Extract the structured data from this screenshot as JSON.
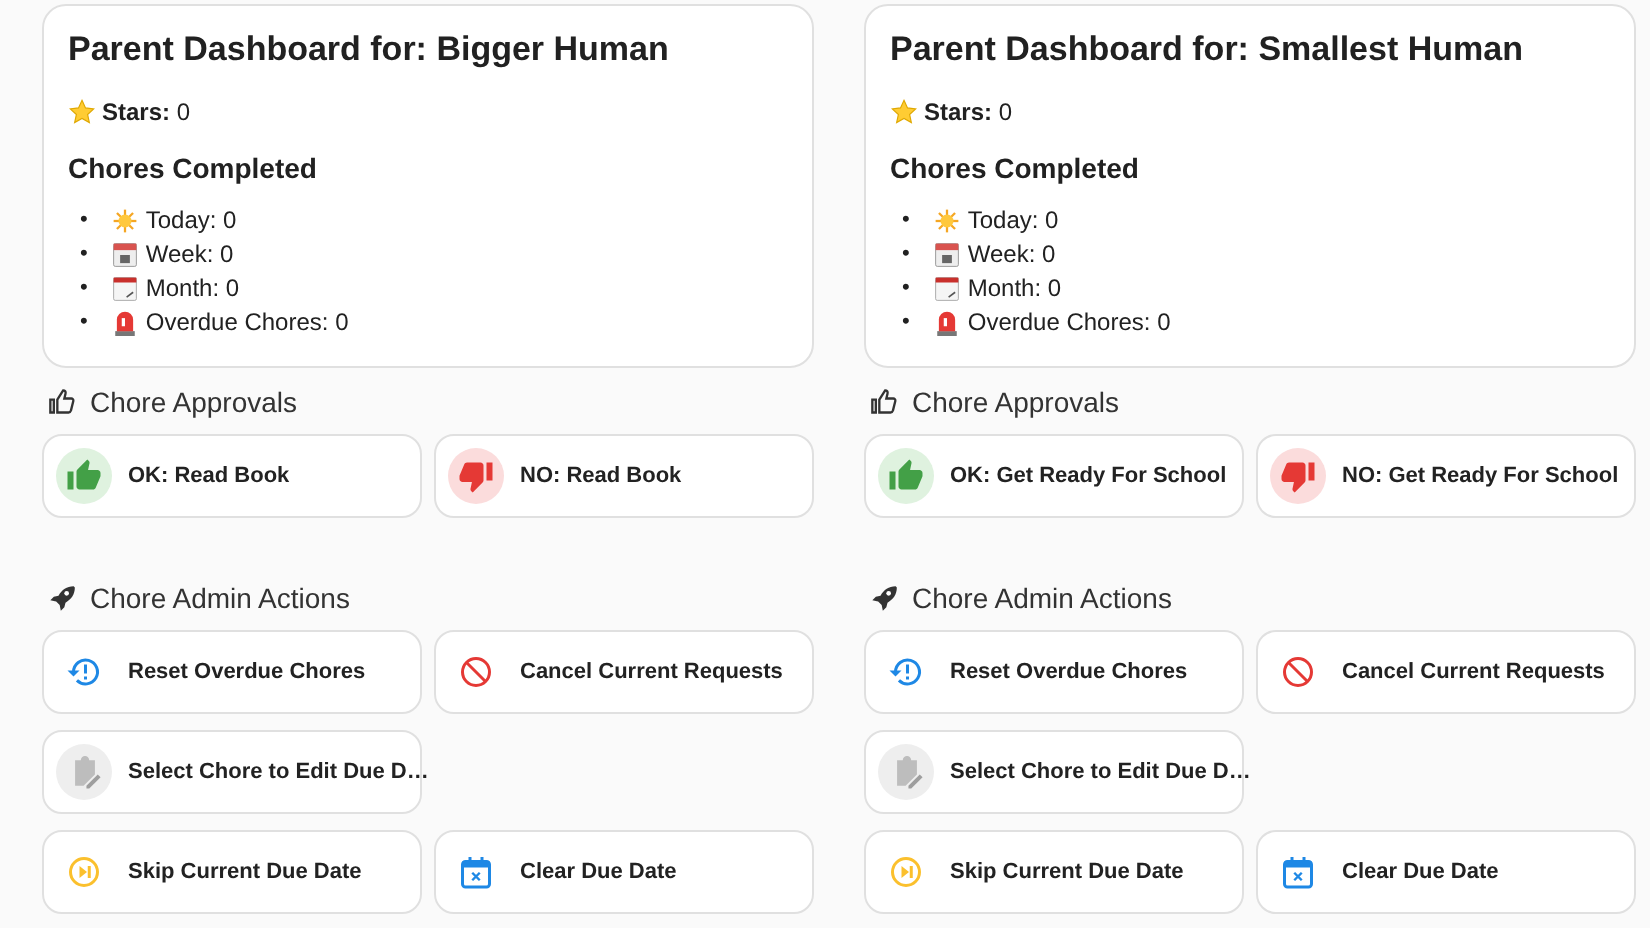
{
  "dashboards": [
    {
      "title": "Parent Dashboard for: Bigger Human",
      "stars": "**Stars:** 0",
      "completed_heading": "Chores Completed",
      "stats": [
        {
          "bullet": "•",
          "kind": "today",
          "text": "Today: 0"
        },
        {
          "bullet": "•",
          "kind": "week",
          "text": "Week: 0"
        },
        {
          "bullet": "•",
          "kind": "month",
          "text": "Month: 0"
        },
        {
          "bullet": "•",
          "kind": "overdue",
          "text": "Overdue Chores: 0"
        }
      ],
      "approvals_heading": "Chore Approvals",
      "approvals": [
        {
          "kind": "ok",
          "label": "OK: Read Book"
        },
        {
          "kind": "no",
          "label": "NO: Read Book"
        }
      ],
      "admin_heading": "Chore Admin Actions",
      "admin_rows": [
        [
          {
            "kind": "reset",
            "label": "Reset Overdue Chores"
          },
          {
            "kind": "cancel",
            "label": "Cancel Current Requests"
          }
        ],
        [
          {
            "kind": "edit",
            "label": "Select Chore to Edit Due D…"
          }
        ],
        [
          {
            "kind": "skip",
            "label": "Skip Current Due Date"
          },
          {
            "kind": "clear",
            "label": "Clear Due Date"
          }
        ]
      ]
    },
    {
      "title": "Parent Dashboard for: Smallest Human",
      "stars": "**Stars:** 0",
      "completed_heading": "Chores Completed",
      "stats": [
        {
          "bullet": "•",
          "kind": "today",
          "text": "Today: 0"
        },
        {
          "bullet": "•",
          "kind": "week",
          "text": "Week: 0"
        },
        {
          "bullet": "•",
          "kind": "month",
          "text": "Month: 0"
        },
        {
          "bullet": "•",
          "kind": "overdue",
          "text": "Overdue Chores: 0"
        }
      ],
      "approvals_heading": "Chore Approvals",
      "approvals": [
        {
          "kind": "ok",
          "label": "OK: Get Ready For School"
        },
        {
          "kind": "no",
          "label": "NO: Get Ready For School"
        }
      ],
      "admin_heading": "Chore Admin Actions",
      "admin_rows": [
        [
          {
            "kind": "reset",
            "label": "Reset Overdue Chores"
          },
          {
            "kind": "cancel",
            "label": "Cancel Current Requests"
          }
        ],
        [
          {
            "kind": "edit",
            "label": "Select Chore to Edit Due D…"
          }
        ],
        [
          {
            "kind": "skip",
            "label": "Skip Current Due Date"
          },
          {
            "kind": "clear",
            "label": "Clear Due Date"
          }
        ]
      ]
    }
  ]
}
